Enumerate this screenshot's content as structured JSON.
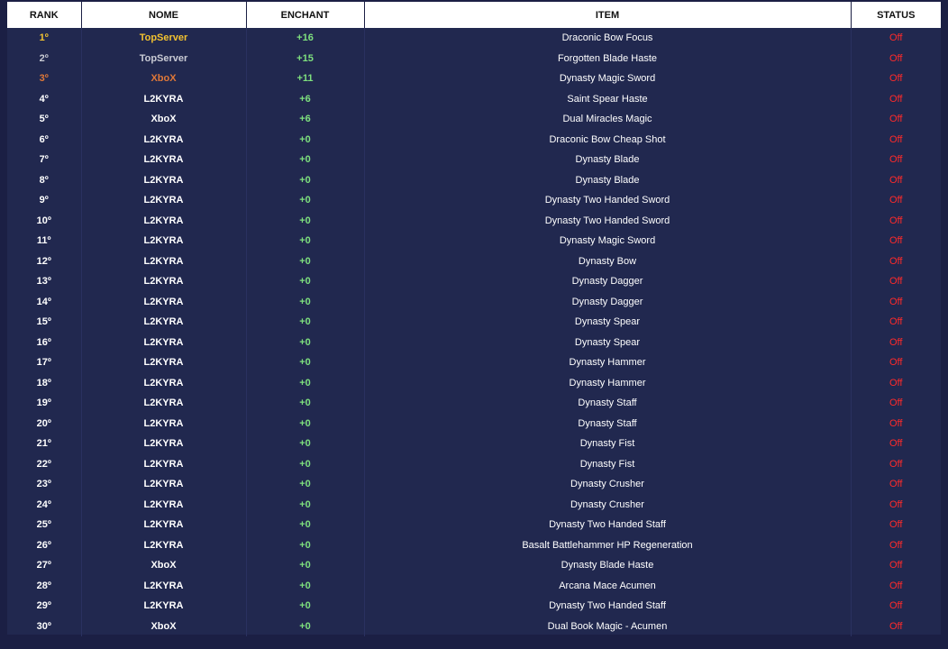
{
  "table": {
    "headers": {
      "rank": "RANK",
      "nome": "NOME",
      "enchant": "ENCHANT",
      "item": "ITEM",
      "status": "STATUS"
    },
    "rows": [
      {
        "rank": "1º",
        "nome": "TopServer",
        "enchant": "+16",
        "item": "Draconic Bow Focus",
        "status": "Off",
        "tier": "gold"
      },
      {
        "rank": "2º",
        "nome": "TopServer",
        "enchant": "+15",
        "item": "Forgotten Blade Haste",
        "status": "Off",
        "tier": "silver"
      },
      {
        "rank": "3º",
        "nome": "XboX",
        "enchant": "+11",
        "item": "Dynasty Magic Sword",
        "status": "Off",
        "tier": "bronze"
      },
      {
        "rank": "4º",
        "nome": "L2KYRA",
        "enchant": "+6",
        "item": "Saint Spear Haste",
        "status": "Off",
        "tier": ""
      },
      {
        "rank": "5º",
        "nome": "XboX",
        "enchant": "+6",
        "item": "Dual Miracles Magic",
        "status": "Off",
        "tier": ""
      },
      {
        "rank": "6º",
        "nome": "L2KYRA",
        "enchant": "+0",
        "item": "Draconic Bow Cheap Shot",
        "status": "Off",
        "tier": ""
      },
      {
        "rank": "7º",
        "nome": "L2KYRA",
        "enchant": "+0",
        "item": "Dynasty Blade",
        "status": "Off",
        "tier": ""
      },
      {
        "rank": "8º",
        "nome": "L2KYRA",
        "enchant": "+0",
        "item": "Dynasty Blade",
        "status": "Off",
        "tier": ""
      },
      {
        "rank": "9º",
        "nome": "L2KYRA",
        "enchant": "+0",
        "item": "Dynasty Two Handed Sword",
        "status": "Off",
        "tier": ""
      },
      {
        "rank": "10º",
        "nome": "L2KYRA",
        "enchant": "+0",
        "item": "Dynasty Two Handed Sword",
        "status": "Off",
        "tier": ""
      },
      {
        "rank": "11º",
        "nome": "L2KYRA",
        "enchant": "+0",
        "item": "Dynasty Magic Sword",
        "status": "Off",
        "tier": ""
      },
      {
        "rank": "12º",
        "nome": "L2KYRA",
        "enchant": "+0",
        "item": "Dynasty Bow",
        "status": "Off",
        "tier": ""
      },
      {
        "rank": "13º",
        "nome": "L2KYRA",
        "enchant": "+0",
        "item": "Dynasty Dagger",
        "status": "Off",
        "tier": ""
      },
      {
        "rank": "14º",
        "nome": "L2KYRA",
        "enchant": "+0",
        "item": "Dynasty Dagger",
        "status": "Off",
        "tier": ""
      },
      {
        "rank": "15º",
        "nome": "L2KYRA",
        "enchant": "+0",
        "item": "Dynasty Spear",
        "status": "Off",
        "tier": ""
      },
      {
        "rank": "16º",
        "nome": "L2KYRA",
        "enchant": "+0",
        "item": "Dynasty Spear",
        "status": "Off",
        "tier": ""
      },
      {
        "rank": "17º",
        "nome": "L2KYRA",
        "enchant": "+0",
        "item": "Dynasty Hammer",
        "status": "Off",
        "tier": ""
      },
      {
        "rank": "18º",
        "nome": "L2KYRA",
        "enchant": "+0",
        "item": "Dynasty Hammer",
        "status": "Off",
        "tier": ""
      },
      {
        "rank": "19º",
        "nome": "L2KYRA",
        "enchant": "+0",
        "item": "Dynasty Staff",
        "status": "Off",
        "tier": ""
      },
      {
        "rank": "20º",
        "nome": "L2KYRA",
        "enchant": "+0",
        "item": "Dynasty Staff",
        "status": "Off",
        "tier": ""
      },
      {
        "rank": "21º",
        "nome": "L2KYRA",
        "enchant": "+0",
        "item": "Dynasty Fist",
        "status": "Off",
        "tier": ""
      },
      {
        "rank": "22º",
        "nome": "L2KYRA",
        "enchant": "+0",
        "item": "Dynasty Fist",
        "status": "Off",
        "tier": ""
      },
      {
        "rank": "23º",
        "nome": "L2KYRA",
        "enchant": "+0",
        "item": "Dynasty Crusher",
        "status": "Off",
        "tier": ""
      },
      {
        "rank": "24º",
        "nome": "L2KYRA",
        "enchant": "+0",
        "item": "Dynasty Crusher",
        "status": "Off",
        "tier": ""
      },
      {
        "rank": "25º",
        "nome": "L2KYRA",
        "enchant": "+0",
        "item": "Dynasty Two Handed Staff",
        "status": "Off",
        "tier": ""
      },
      {
        "rank": "26º",
        "nome": "L2KYRA",
        "enchant": "+0",
        "item": "Basalt Battlehammer HP Regeneration",
        "status": "Off",
        "tier": ""
      },
      {
        "rank": "27º",
        "nome": "XboX",
        "enchant": "+0",
        "item": "Dynasty Blade Haste",
        "status": "Off",
        "tier": ""
      },
      {
        "rank": "28º",
        "nome": "L2KYRA",
        "enchant": "+0",
        "item": "Arcana Mace Acumen",
        "status": "Off",
        "tier": ""
      },
      {
        "rank": "29º",
        "nome": "L2KYRA",
        "enchant": "+0",
        "item": "Dynasty Two Handed Staff",
        "status": "Off",
        "tier": ""
      },
      {
        "rank": "30º",
        "nome": "XboX",
        "enchant": "+0",
        "item": "Dual Book Magic - Acumen",
        "status": "Off",
        "tier": ""
      }
    ]
  },
  "colors": {
    "background": "#1b1f44",
    "table_body": "#21284f",
    "header_bg": "#ffffff",
    "enchant": "#7ee07e",
    "status_off": "#ff2a2a",
    "gold": "#f2c230",
    "silver": "#c9cbd4",
    "bronze": "#e07838"
  }
}
